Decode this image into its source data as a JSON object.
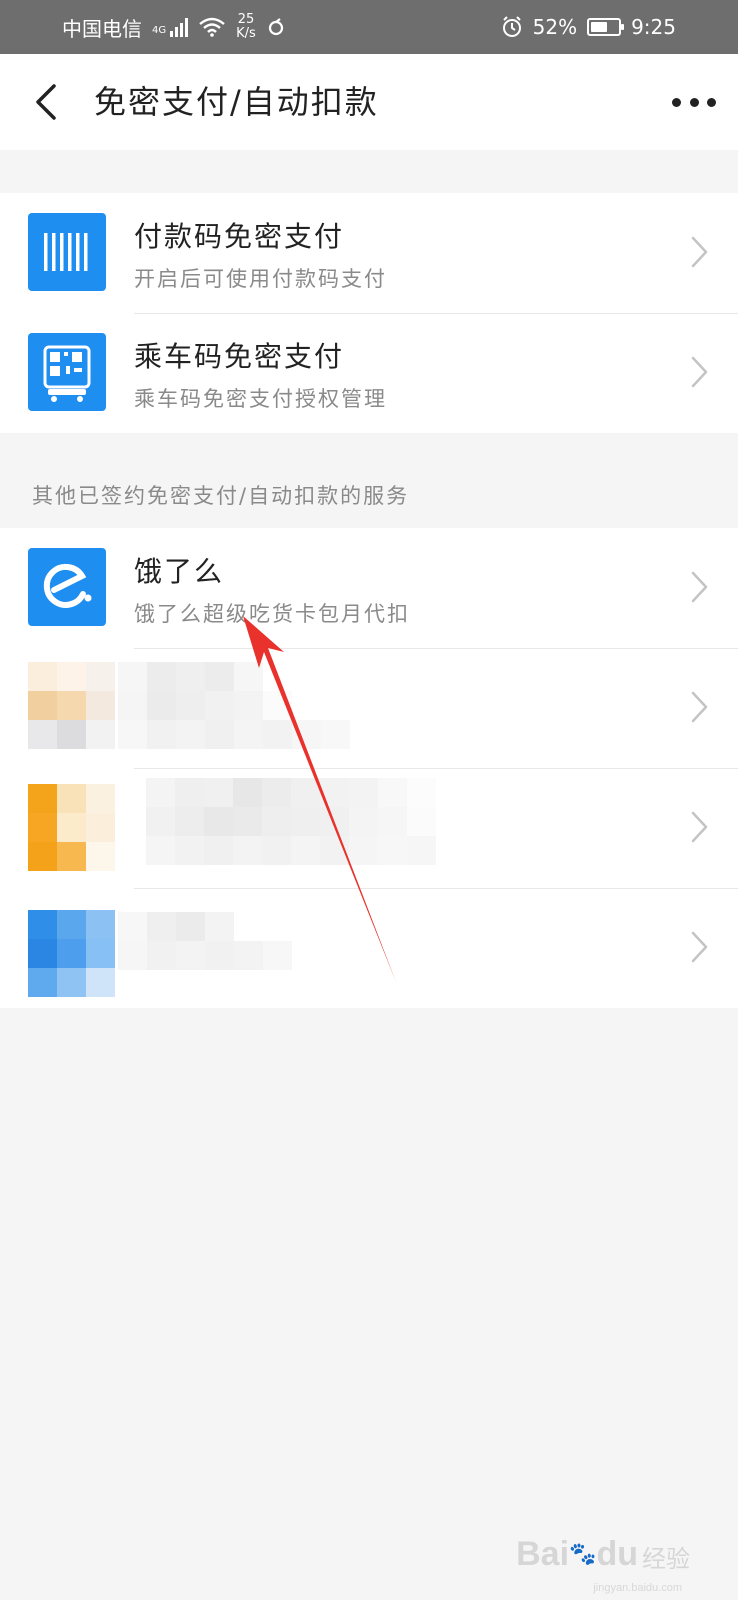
{
  "status_bar": {
    "carrier": "中国电信",
    "network": "4G",
    "speed_value": "25",
    "speed_unit": "K/s",
    "battery": "52%",
    "time": "9:25"
  },
  "header": {
    "title": "免密支付/自动扣款"
  },
  "group_1": {
    "items": [
      {
        "title": "付款码免密支付",
        "subtitle": "开启后可使用付款码支付",
        "icon": "barcode-icon"
      },
      {
        "title": "乘车码免密支付",
        "subtitle": "乘车码免密支付授权管理",
        "icon": "bus-qr-icon"
      }
    ]
  },
  "section_label": "其他已签约免密支付/自动扣款的服务",
  "group_2": {
    "items": [
      {
        "title": "饿了么",
        "subtitle": "饿了么超级吃货卡包月代扣",
        "icon": "eleme-icon"
      }
    ]
  },
  "watermark": {
    "logo": "Bai",
    "logo_du": "du",
    "cn": "经验",
    "url": "jingyan.baidu.com"
  },
  "colors": {
    "alipay_blue": "#1e8ef0",
    "accent_red": "#e8322b"
  }
}
